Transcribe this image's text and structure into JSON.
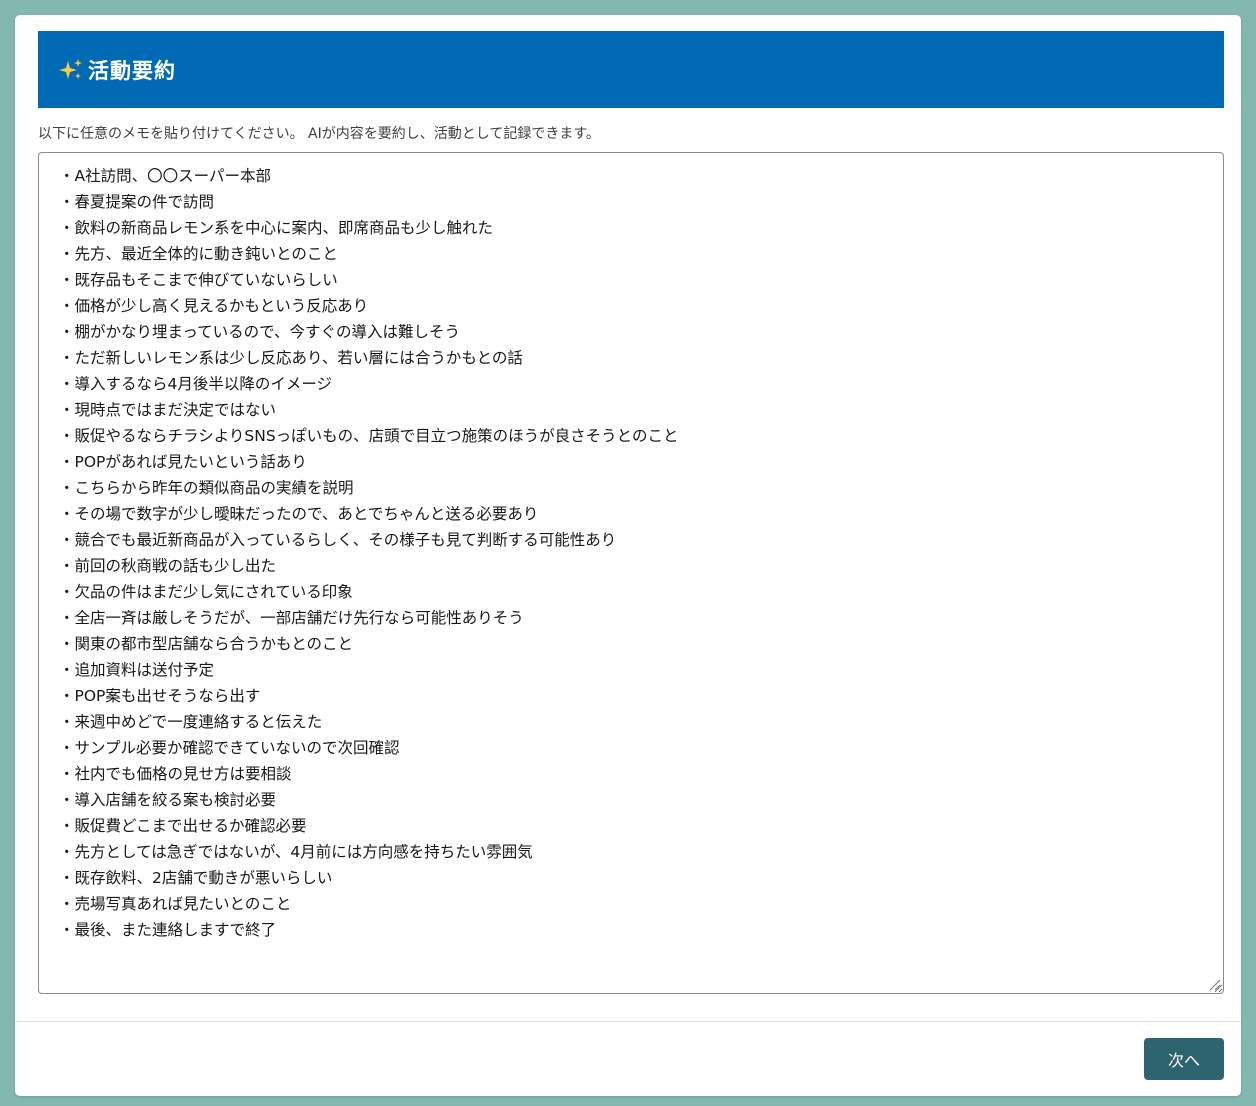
{
  "modal": {
    "title": "活動要約",
    "title_icon": "sparkle-icon",
    "instruction": "以下に任意のメモを貼り付けてください。 AIが内容を要約し、活動として記録できます。",
    "memo_text": "・A社訪問、〇〇スーパー本部\n・春夏提案の件で訪問\n・飲料の新商品レモン系を中心に案内、即席商品も少し触れた\n・先方、最近全体的に動き鈍いとのこと\n・既存品もそこまで伸びていないらしい\n・価格が少し高く見えるかもという反応あり\n・棚がかなり埋まっているので、今すぐの導入は難しそう\n・ただ新しいレモン系は少し反応あり、若い層には合うかもとの話\n・導入するなら4月後半以降のイメージ\n・現時点ではまだ決定ではない\n・販促やるならチラシよりSNSっぽいもの、店頭で目立つ施策のほうが良さそうとのこと\n・POPがあれば見たいという話あり\n・こちらから昨年の類似商品の実績を説明\n・その場で数字が少し曖昧だったので、あとでちゃんと送る必要あり\n・競合でも最近新商品が入っているらしく、その様子も見て判断する可能性あり\n・前回の秋商戦の話も少し出た\n・欠品の件はまだ少し気にされている印象\n・全店一斉は厳しそうだが、一部店舗だけ先行なら可能性ありそう\n・関東の都市型店舗なら合うかもとのこと\n・追加資料は送付予定\n・POP案も出せそうなら出す\n・来週中めどで一度連絡すると伝えた\n・サンプル必要か確認できていないので次回確認\n・社内でも価格の見せ方は要相談\n・導入店舗を絞る案も検討必要\n・販促費どこまで出せるか確認必要\n・先方としては急ぎではないが、4月前には方向感を持ちたい雰囲気\n・既存飲料、2店舗で動きが悪いらしい\n・売場写真あれば見たいとのこと\n・最後、また連絡しますで終了",
    "next_label": "次へ"
  },
  "colors": {
    "header_bg": "#006bb4",
    "button_bg": "#2e6370",
    "backdrop": "#83b8b0",
    "sparkle": "#f7c948"
  }
}
